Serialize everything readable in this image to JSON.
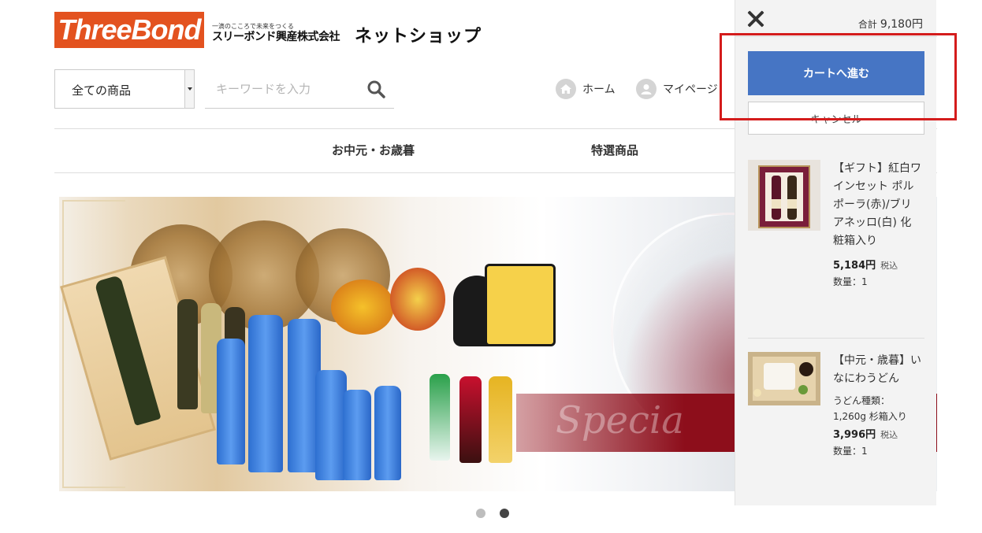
{
  "header": {
    "logo_text": "ThreeBond",
    "company_tagline": "一滴のこころで未来をつくる",
    "company_name": "スリーボンド興産株式会社",
    "shop_title": "ネットショップ"
  },
  "search": {
    "category_selected": "全ての商品",
    "placeholder": "キーワードを入力"
  },
  "nav": {
    "home_label": "ホーム",
    "mypage_label": "マイページ"
  },
  "menu": [
    {
      "label": "お中元・お歳暮"
    },
    {
      "label": "特選商品"
    }
  ],
  "banner": {
    "overlay_text": "Specia"
  },
  "carousel": {
    "slide_count": 2,
    "active_index": 1
  },
  "cart": {
    "total_label": "合計",
    "total_value": "9,180円",
    "proceed_button": "カートへ進む",
    "cancel_button": "キャンセル",
    "items": [
      {
        "title": "【ギフト】紅白ワインセット ポルポーラ(赤)/ブリアネッロ(白) 化粧箱入り",
        "desc": "",
        "price": "5,184円",
        "tax_label": "税込",
        "qty": "数量：1"
      },
      {
        "title": "【中元・歳暮】いなにわうどん",
        "desc": "うどん種類：1,260g 杉箱入り",
        "price": "3,996円",
        "tax_label": "税込",
        "qty": "数量：1"
      }
    ]
  },
  "colors": {
    "brand_orange": "#e3521f",
    "primary_button": "#4675c4",
    "highlight_red": "#d41c1c"
  }
}
